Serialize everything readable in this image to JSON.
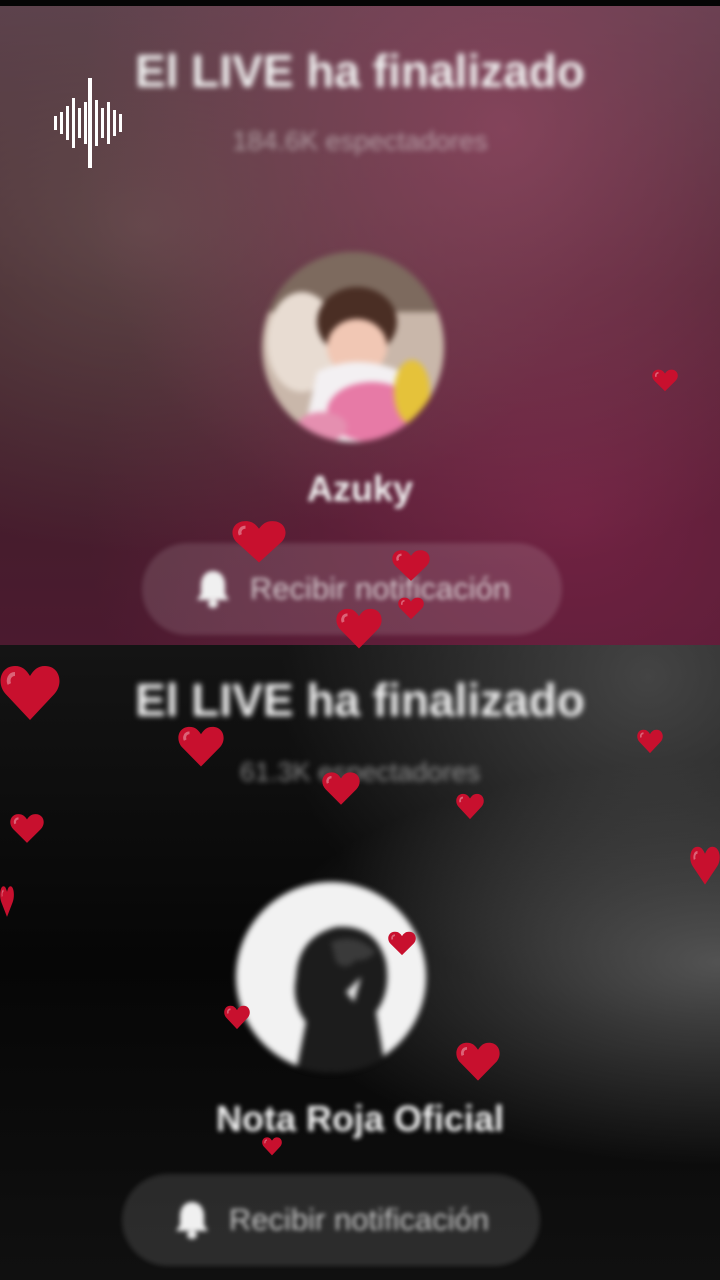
{
  "colors": {
    "heart": "#c8102e",
    "top_panel": "#4b2a35",
    "bottom_panel": "#0a0a0a"
  },
  "overlay": {
    "icon": "audio-waveform-icon"
  },
  "streams": [
    {
      "title": "El LIVE ha finalizado",
      "viewers": "184.6K espectadores",
      "username": "Azuky",
      "notify_label": "Recibir notificación",
      "notify_icon": "bell-icon"
    },
    {
      "title": "El LIVE ha finalizado",
      "viewers": "61.3K espectadores",
      "username": "Nota Roja Oficial",
      "notify_label": "Recibir notificación",
      "notify_icon": "bell-icon"
    }
  ],
  "decorations": {
    "icon": "heart-icon"
  }
}
